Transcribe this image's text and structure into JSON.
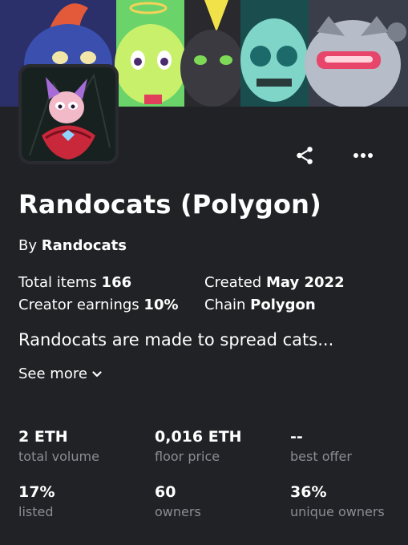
{
  "collection": {
    "name": "Randocats (Polygon)",
    "by_prefix": "By",
    "creator": "Randocats",
    "description": "Randocats are made to spread cats..."
  },
  "details": {
    "total_items_label": "Total items",
    "total_items_value": "166",
    "created_label": "Created",
    "created_value": "May 2022",
    "creator_earnings_label": "Creator earnings",
    "creator_earnings_value": "10%",
    "chain_label": "Chain",
    "chain_value": "Polygon"
  },
  "see_more_label": "See more",
  "stats": [
    {
      "value": "2 ETH",
      "label": "total volume"
    },
    {
      "value": "0,016 ETH",
      "label": "floor price"
    },
    {
      "value": "--",
      "label": "best offer"
    },
    {
      "value": "17%",
      "label": "listed"
    },
    {
      "value": "60",
      "label": "owners"
    },
    {
      "value": "36%",
      "label": "unique owners"
    }
  ],
  "icons": {
    "share": "share-icon",
    "more": "more-options-icon",
    "chevron": "chevron-down-icon"
  },
  "colors": {
    "background": "#202225",
    "text": "#ffffff",
    "muted": "#8a8d93"
  }
}
